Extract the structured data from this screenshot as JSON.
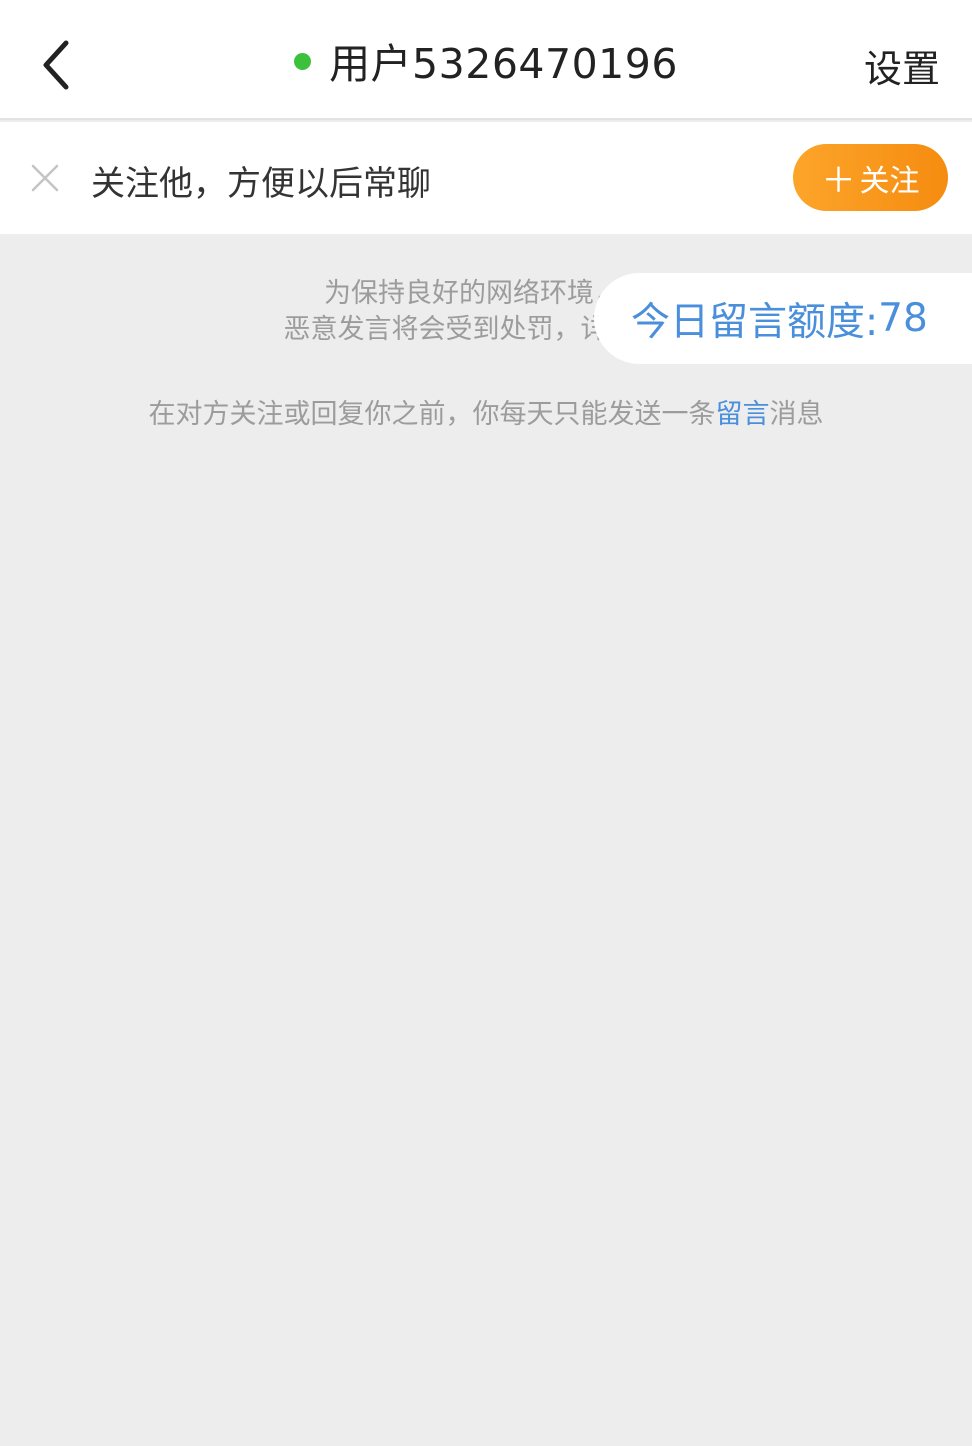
{
  "colors": {
    "online_dot": "#3cc13b",
    "accent_link": "#4a8fdb",
    "follow_gradient_start": "#fca52a",
    "follow_gradient_end": "#f58c10"
  },
  "header": {
    "back_icon": "chevron-left-icon",
    "title": "用户5326470196",
    "settings_label": "设置"
  },
  "follow_bar": {
    "close_icon": "close-icon",
    "prompt": "关注他，方便以后常聊",
    "button_plus": "＋",
    "button_label": "关注"
  },
  "notice": {
    "line1": "为保持良好的网络环境，请",
    "line2": "恶意发言将会受到处罚，详细细则"
  },
  "quota": {
    "label": "今日留言额度:",
    "value": "78"
  },
  "limit_note": {
    "before": "在对方关注或回复你之前，你每天只能发送一条",
    "link": "留言",
    "after": "消息"
  }
}
